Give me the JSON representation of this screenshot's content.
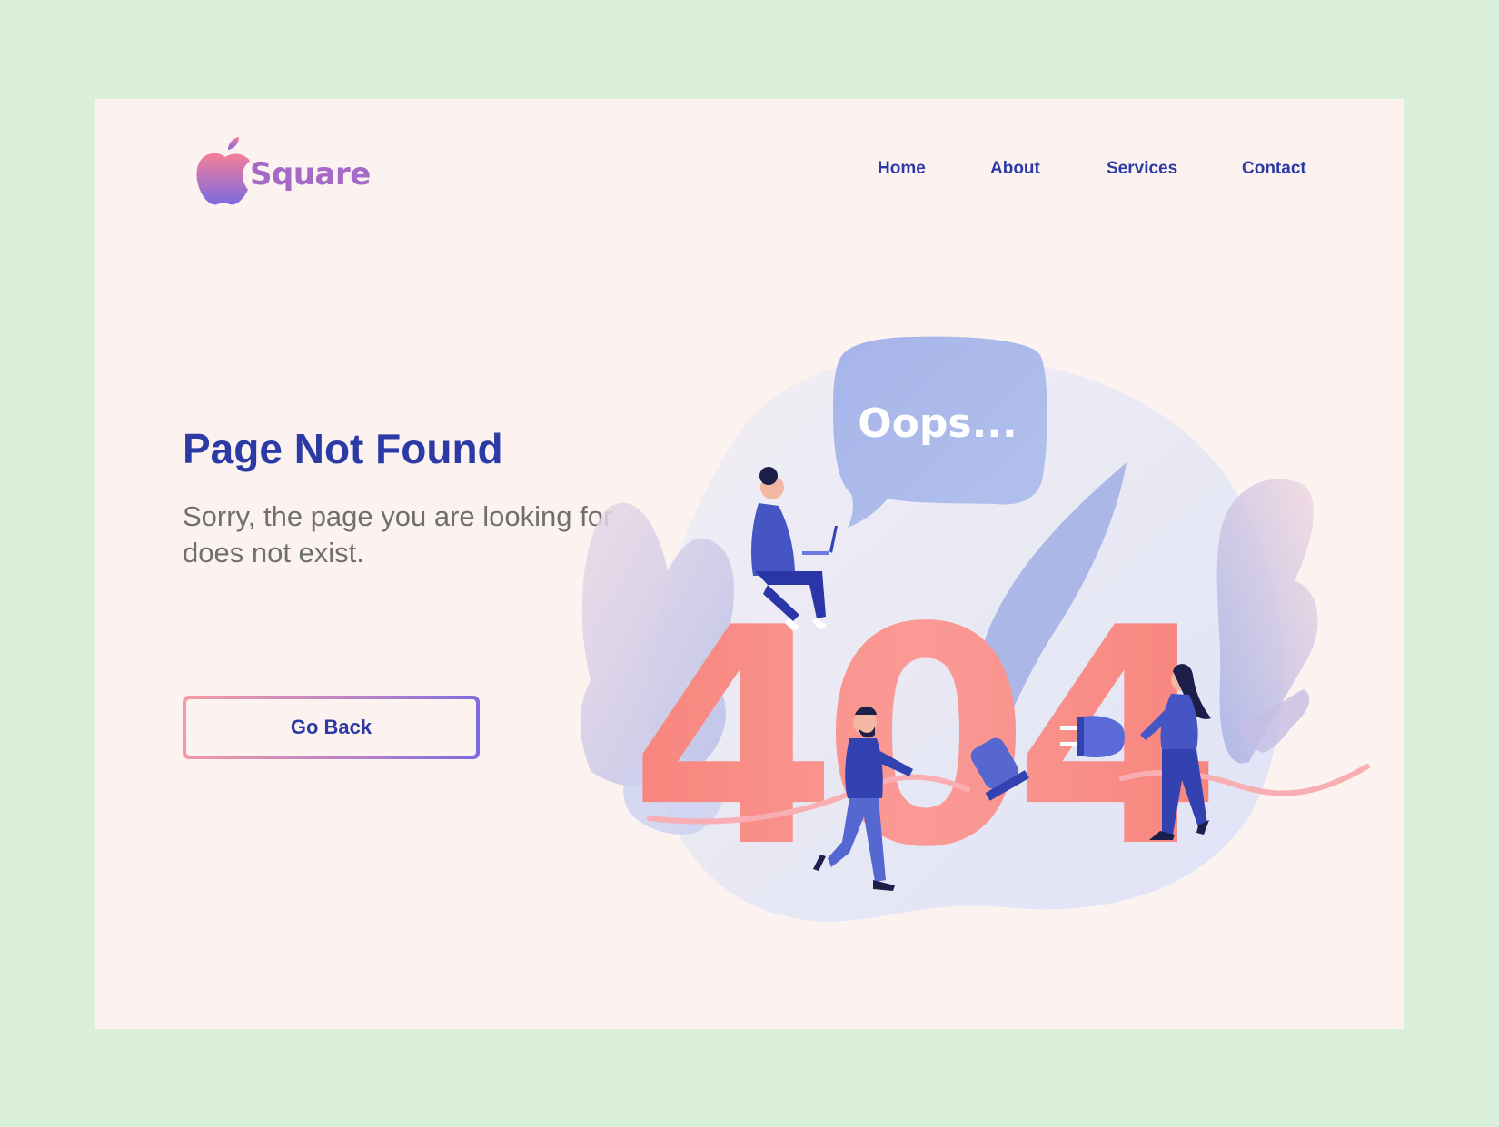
{
  "brand": {
    "name": "Square",
    "logo_icon": "apple-icon",
    "gradient": [
      "#f67e98",
      "#7b6ae0"
    ]
  },
  "nav": {
    "items": [
      "Home",
      "About",
      "Services",
      "Contact"
    ]
  },
  "hero": {
    "title": "Page Not Found",
    "subtitle": "Sorry, the page you are looking for does not exist.",
    "button_label": "Go Back"
  },
  "illustration": {
    "big_text": "404",
    "bubble_text": "Oops..."
  },
  "colors": {
    "page_bg": "#daf0db",
    "card_bg": "#fcf3f1",
    "primary": "#2c3aa6",
    "muted_text": "#6f6f6f",
    "coral": "#f7857d",
    "lavender": "#aab9ea"
  }
}
